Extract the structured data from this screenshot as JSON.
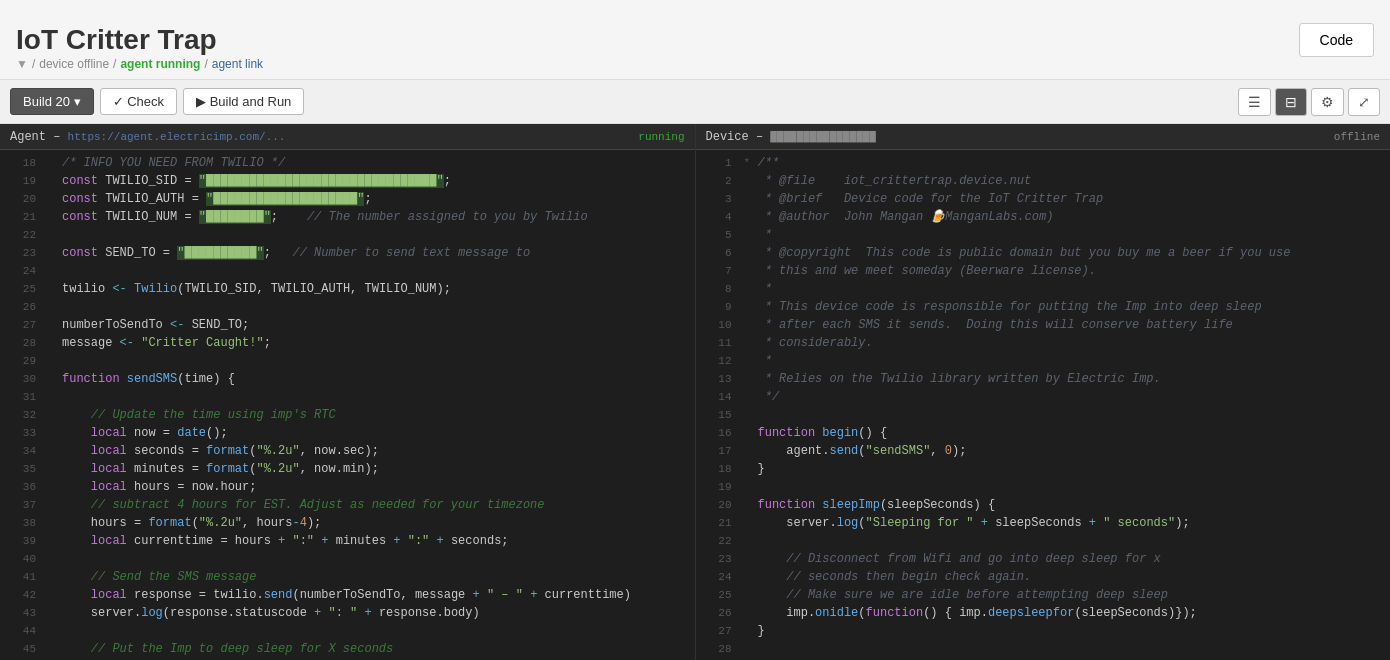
{
  "app": {
    "title": "IoT Critter Trap"
  },
  "status": {
    "device": "device offline",
    "agent": "agent running",
    "link": "agent link",
    "sep1": "/",
    "sep2": "/",
    "sep3": "/",
    "arrow": "▼"
  },
  "toolbar": {
    "build_label": "Build 20 ▾",
    "check_label": "✓ Check",
    "run_label": "▶ Build and Run",
    "code_button": "Code"
  },
  "agent_pane": {
    "title": "Agent",
    "url": "https://agent.electricimp.com/...",
    "status": "running"
  },
  "device_pane": {
    "title": "Device",
    "url": "iot_crittertrap.device.nut",
    "status": "offline"
  }
}
